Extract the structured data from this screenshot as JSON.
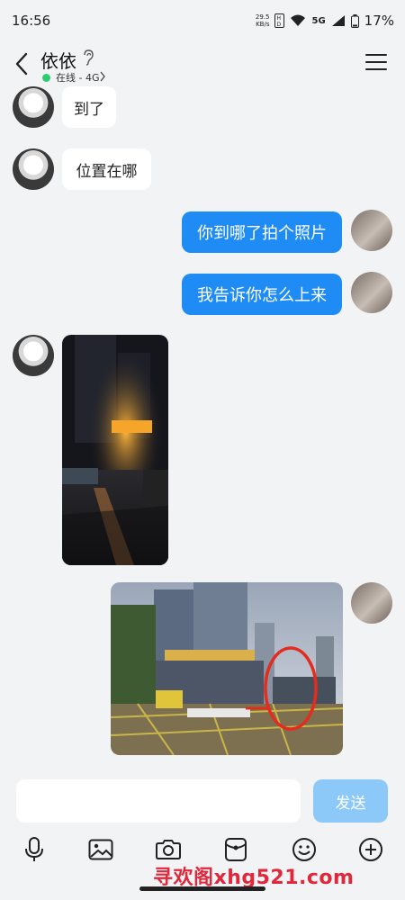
{
  "status": {
    "time": "16:56",
    "net_speed_value": "29.5",
    "net_speed_unit": "KB/s",
    "network": "5G",
    "battery": "17%"
  },
  "header": {
    "name": "依依",
    "online": "在线 - 4G"
  },
  "messages": {
    "m1": "到了",
    "m2": "位置在哪",
    "m3": "你到哪了拍个照片",
    "m4": "我告诉你怎么上来"
  },
  "input": {
    "send_label": "发送"
  },
  "watermark": "寻欢阁xhg521.com",
  "colors": {
    "accent": "#1f8cf5",
    "send_disabled": "#8cc8f8",
    "online": "#2ecc71",
    "annotation": "#e52a1e"
  }
}
